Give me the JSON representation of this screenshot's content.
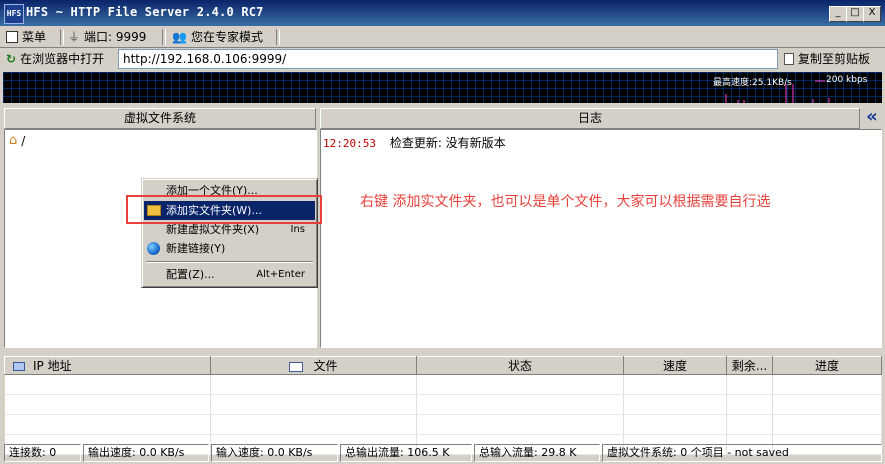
{
  "window": {
    "title": "HFS ~ HTTP File Server 2.4.0 RC7",
    "logo_text": "HFS",
    "min": "_",
    "max": "□",
    "close": "X"
  },
  "toolbar": {
    "menu": "菜单",
    "port": "端口: 9999",
    "mode": "您在专家模式"
  },
  "urlbar": {
    "open_in_browser": "在浏览器中打开",
    "url": "http://192.168.0.106:9999/",
    "copy_clipboard": "复制至剪贴板"
  },
  "graph": {
    "max_speed": "最高速度:25.1KB/s",
    "scale": "200 kbps"
  },
  "vfs": {
    "header": "虚拟文件系统",
    "root": "/"
  },
  "log": {
    "header": "日志",
    "collapse": "«",
    "entries": [
      {
        "time": "12:20:53",
        "message": "检查更新: 没有新版本"
      }
    ]
  },
  "annotation": "右键 添加实文件夹，也可以是单个文件，大家可以根据需要自行选",
  "context_menu": {
    "items": [
      {
        "label": "添加一个文件(Y)...",
        "shortcut": ""
      },
      {
        "label": "添加实文件夹(W)...",
        "shortcut": "",
        "selected": true
      },
      {
        "label": "新建虚拟文件夹(X)",
        "shortcut": "Ins"
      },
      {
        "label": "新建链接(Y)",
        "shortcut": ""
      },
      {
        "label": "配置(Z)...",
        "shortcut": "Alt+Enter"
      }
    ]
  },
  "transfers": {
    "columns": [
      "IP 地址",
      "文件",
      "状态",
      "速度",
      "剩余...",
      "进度"
    ]
  },
  "statusbar": {
    "connections": "连接数: 0",
    "out_speed": "输出速度: 0.0 KB/s",
    "in_speed": "输入速度: 0.0 KB/s",
    "total_out": "总输出流量: 106.5 K",
    "total_in": "总输入流量: 29.8 K",
    "vfs_status": "虚拟文件系统: 0 个项目 - not saved"
  },
  "colors": {
    "annotation_red": "#e8403a",
    "highlight_box": "#e8403a",
    "menu_selection": "#0a246a",
    "log_time": "#c00000"
  }
}
